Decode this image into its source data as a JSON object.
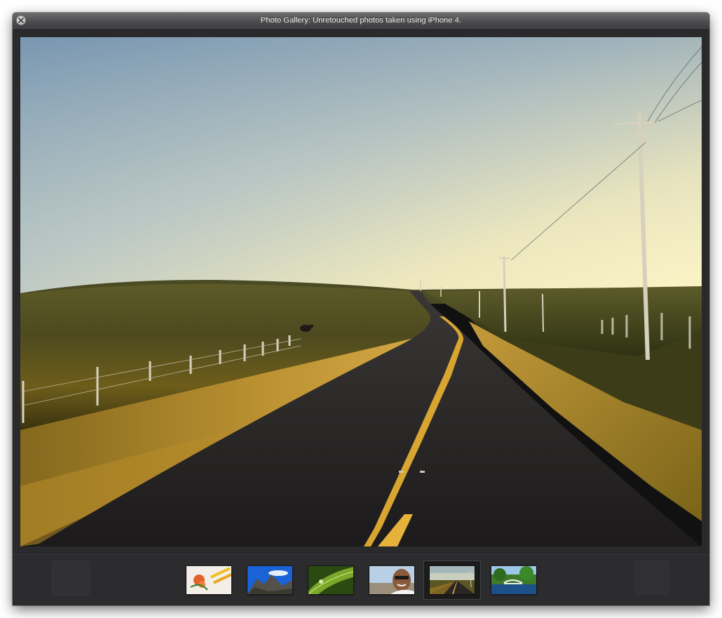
{
  "window": {
    "title": "Photo Gallery: Unretouched photos taken using iPhone 4."
  },
  "icons": {
    "close": "close-icon"
  },
  "photo": {
    "subject": "country-road-at-sunset"
  },
  "filmstrip": {
    "selected_index": 4,
    "thumbnails": [
      {
        "subject": "orange-flower-and-pencils"
      },
      {
        "subject": "mountain-under-blue-sky"
      },
      {
        "subject": "green-leaf-with-water-drop"
      },
      {
        "subject": "smiling-man-with-sunglasses"
      },
      {
        "subject": "country-road-at-sunset"
      },
      {
        "subject": "japanese-garden-pond"
      }
    ]
  },
  "colors": {
    "window_bg": "#2a2a2c",
    "titlebar_text": "#f4f4f4",
    "sky_top": "#8aa6bd",
    "sky_horizon": "#f6f0c2",
    "road_line": "#e8b43a"
  }
}
